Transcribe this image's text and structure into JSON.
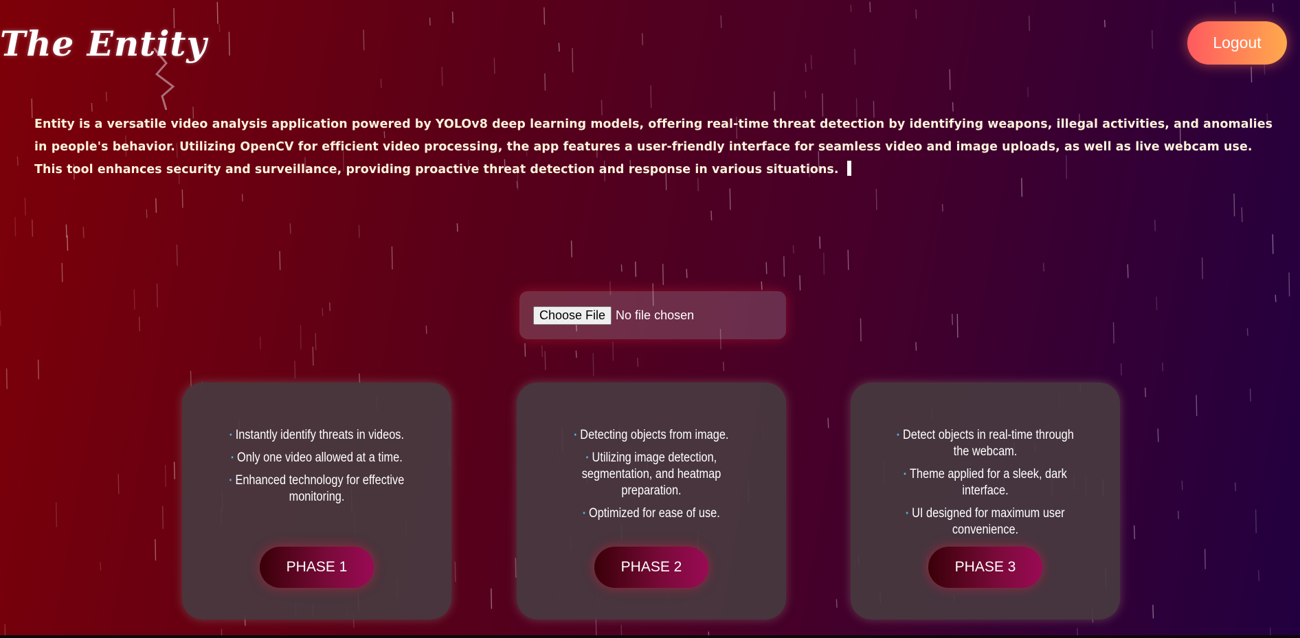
{
  "header": {
    "brand": "The Entity",
    "logout_label": "Logout"
  },
  "intro": {
    "text": "Entity is a versatile video analysis application powered by YOLOv8 deep learning models, offering real-time threat detection by identifying weapons, illegal activities, and anomalies in people's behavior. Utilizing OpenCV for efficient video processing, the app features a user-friendly interface for seamless video and image uploads, as well as live webcam use. This tool enhances security and surveillance, providing proactive threat detection and response in various situations."
  },
  "upload": {
    "button_label": "Choose File",
    "status": "No file chosen"
  },
  "cards": [
    {
      "items": [
        "Instantly identify threats in videos.",
        "Only one video allowed at a time.",
        "Enhanced technology for effective monitoring."
      ],
      "button_label": "PHASE 1"
    },
    {
      "items": [
        "Detecting objects from image.",
        "Utilizing image detection, segmentation, and heatmap preparation.",
        "Optimized for ease of use."
      ],
      "button_label": "PHASE 2"
    },
    {
      "items": [
        "Detect objects in real-time through the webcam.",
        "Theme applied for a sleek, dark interface.",
        "UI designed for maximum user convenience."
      ],
      "button_label": "PHASE 3"
    }
  ],
  "colors": {
    "logout_gradient_start": "#ff5a5f",
    "logout_gradient_end": "#ffa94d",
    "bullet": "#4fb3e8",
    "intro_text": "#fdf3dc"
  },
  "icons": {
    "bolt": "lightning-bolt-icon",
    "bullet": "bullet-dot-icon"
  }
}
